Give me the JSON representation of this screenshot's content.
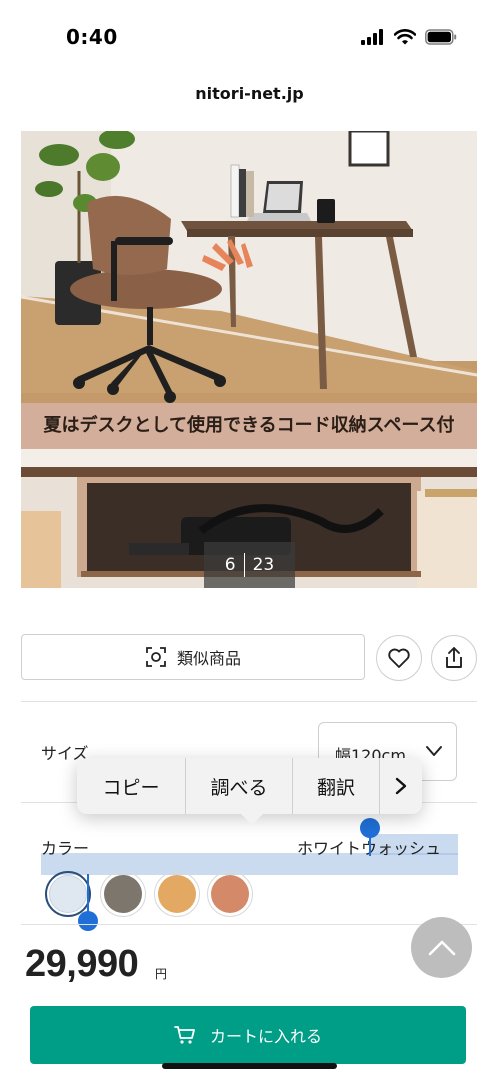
{
  "status_bar": {
    "time": "0:40"
  },
  "browser": {
    "url": "nitori-net.jp"
  },
  "hero": {
    "caption": "夏はデスクとして使用できるコード収納スペース付",
    "pager": {
      "current": "6",
      "total": "23"
    }
  },
  "actions": {
    "similar_label": "類似商品",
    "favorite_icon": "heart-icon",
    "share_icon": "share-icon"
  },
  "size": {
    "label": "サイズ",
    "value": "幅120cm"
  },
  "context_menu": {
    "items": [
      "コピー",
      "調べる",
      "翻訳"
    ],
    "more": "›"
  },
  "color": {
    "label": "カラー",
    "value": "ホワイトウォッシュ",
    "swatches": [
      "#dfe7f0",
      "#7d766c",
      "#e3a862",
      "#d48a68"
    ]
  },
  "price": {
    "amount": "29,990",
    "unit": "円"
  },
  "cart": {
    "label": "カートに入れる"
  },
  "colors": {
    "accent": "#009e86",
    "selection": "#1f6fd6"
  }
}
